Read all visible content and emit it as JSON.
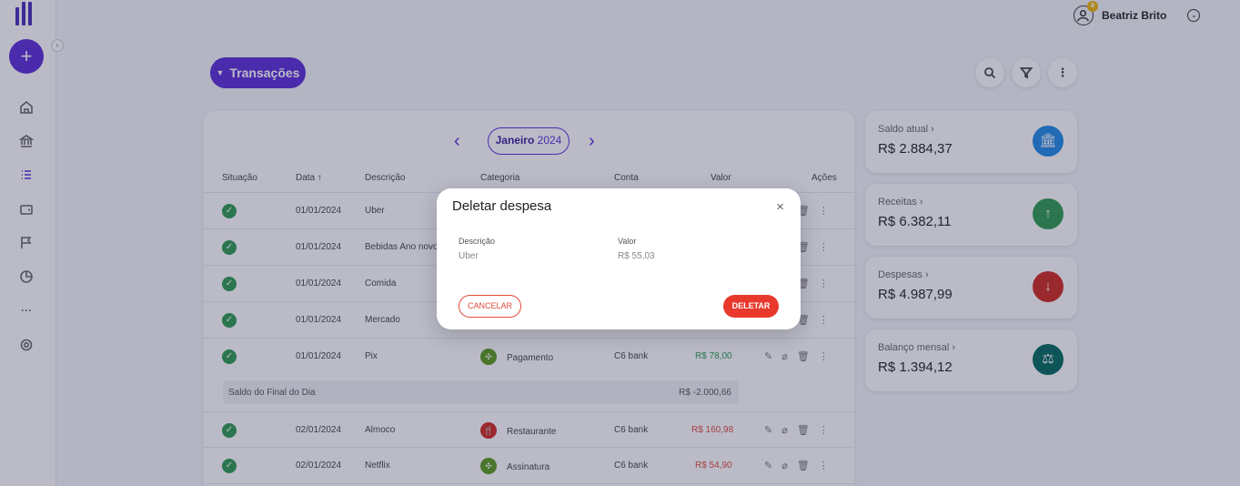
{
  "user": {
    "name": "Beatriz Brito"
  },
  "page": {
    "section_label": "Transações"
  },
  "month_nav": {
    "month": "Janeiro",
    "year": "2024"
  },
  "table": {
    "headers": {
      "status": "Situação",
      "date": "Data",
      "description": "Descrição",
      "category": "Categoria",
      "account": "Conta",
      "value": "Valor",
      "actions": "Ações"
    },
    "rows": [
      {
        "date": "01/01/2024",
        "description": "Uber"
      },
      {
        "date": "01/01/2024",
        "description": "Bebidas Ano novo"
      },
      {
        "date": "01/01/2024",
        "description": "Comida"
      },
      {
        "date": "01/01/2024",
        "description": "Mercado"
      },
      {
        "date": "01/01/2024",
        "description": "Pix",
        "category": "Pagamento",
        "account": "C6 bank",
        "value": "R$ 78,00",
        "value_color": "#2e9a4f",
        "cat_color": "#5a9a1a"
      },
      {
        "date": "02/01/2024",
        "description": "Almoco",
        "category": "Restaurante",
        "account": "C6 bank",
        "value": "R$ 160,98",
        "value_color": "#e04a3a",
        "cat_color": "#d0281e"
      },
      {
        "date": "02/01/2024",
        "description": "Netflix",
        "category": "Assinatura",
        "account": "C6 bank",
        "value": "R$ 54,90",
        "value_color": "#e04a3a",
        "cat_color": "#5a9a1a"
      }
    ],
    "subtotal": {
      "label": "Saldo do Final do Dia",
      "value": "R$ -2.000,66"
    }
  },
  "summary": [
    {
      "label": "Saldo atual",
      "value": "R$ 2.884,37",
      "color": "#1e88e5"
    },
    {
      "label": "Receitas",
      "value": "R$ 6.382,11",
      "color": "#2e9a4f"
    },
    {
      "label": "Despesas",
      "value": "R$ 4.987,99",
      "color": "#d0281e"
    },
    {
      "label": "Balanço mensal",
      "value": "R$ 1.394,12",
      "color": "#00695c"
    }
  ],
  "modal": {
    "title": "Deletar despesa",
    "fields": [
      {
        "label": "Descrição",
        "value": "Uber"
      },
      {
        "label": "Valor",
        "value": "R$ 55,03"
      }
    ],
    "cancel_label": "CANCELAR",
    "delete_label": "DELETAR"
  }
}
